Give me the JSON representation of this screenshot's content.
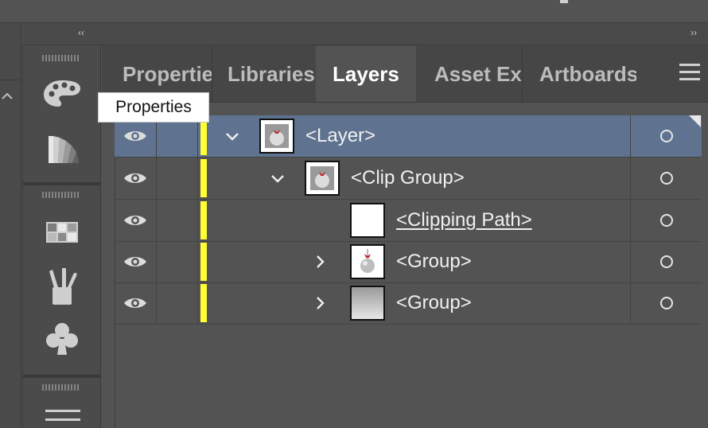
{
  "colors": {
    "panel_bg": "#535353",
    "selected_row": "#5f7390",
    "layer_color": "#ffff33",
    "tooltip_bg": "#ffffff"
  },
  "collapse": {
    "left": "‹‹",
    "right": "››"
  },
  "tooltip": {
    "text": "Properties"
  },
  "tabs": [
    {
      "label": "Properties",
      "active": false
    },
    {
      "label": "Libraries",
      "active": false
    },
    {
      "label": "Layers",
      "active": true
    },
    {
      "label": "Asset Export",
      "active": false
    },
    {
      "label": "Artboards",
      "active": false
    }
  ],
  "toolbar_icons": [
    "palette-icon",
    "color-guide-icon",
    "swatches-icon",
    "brushes-icon",
    "symbols-icon",
    "stroke-icon"
  ],
  "layers": [
    {
      "name": "<Layer>",
      "twirl": "open",
      "selected": true,
      "thumb": "ornament"
    },
    {
      "name": "<Clip Group>",
      "twirl": "open",
      "selected": false,
      "thumb": "ornament"
    },
    {
      "name": "<Clipping Path>",
      "twirl": "none",
      "selected": false,
      "thumb": "blank"
    },
    {
      "name": "<Group>",
      "twirl": "closed",
      "selected": false,
      "thumb": "ornament-full"
    },
    {
      "name": "<Group>",
      "twirl": "closed",
      "selected": false,
      "thumb": "gradient"
    }
  ]
}
